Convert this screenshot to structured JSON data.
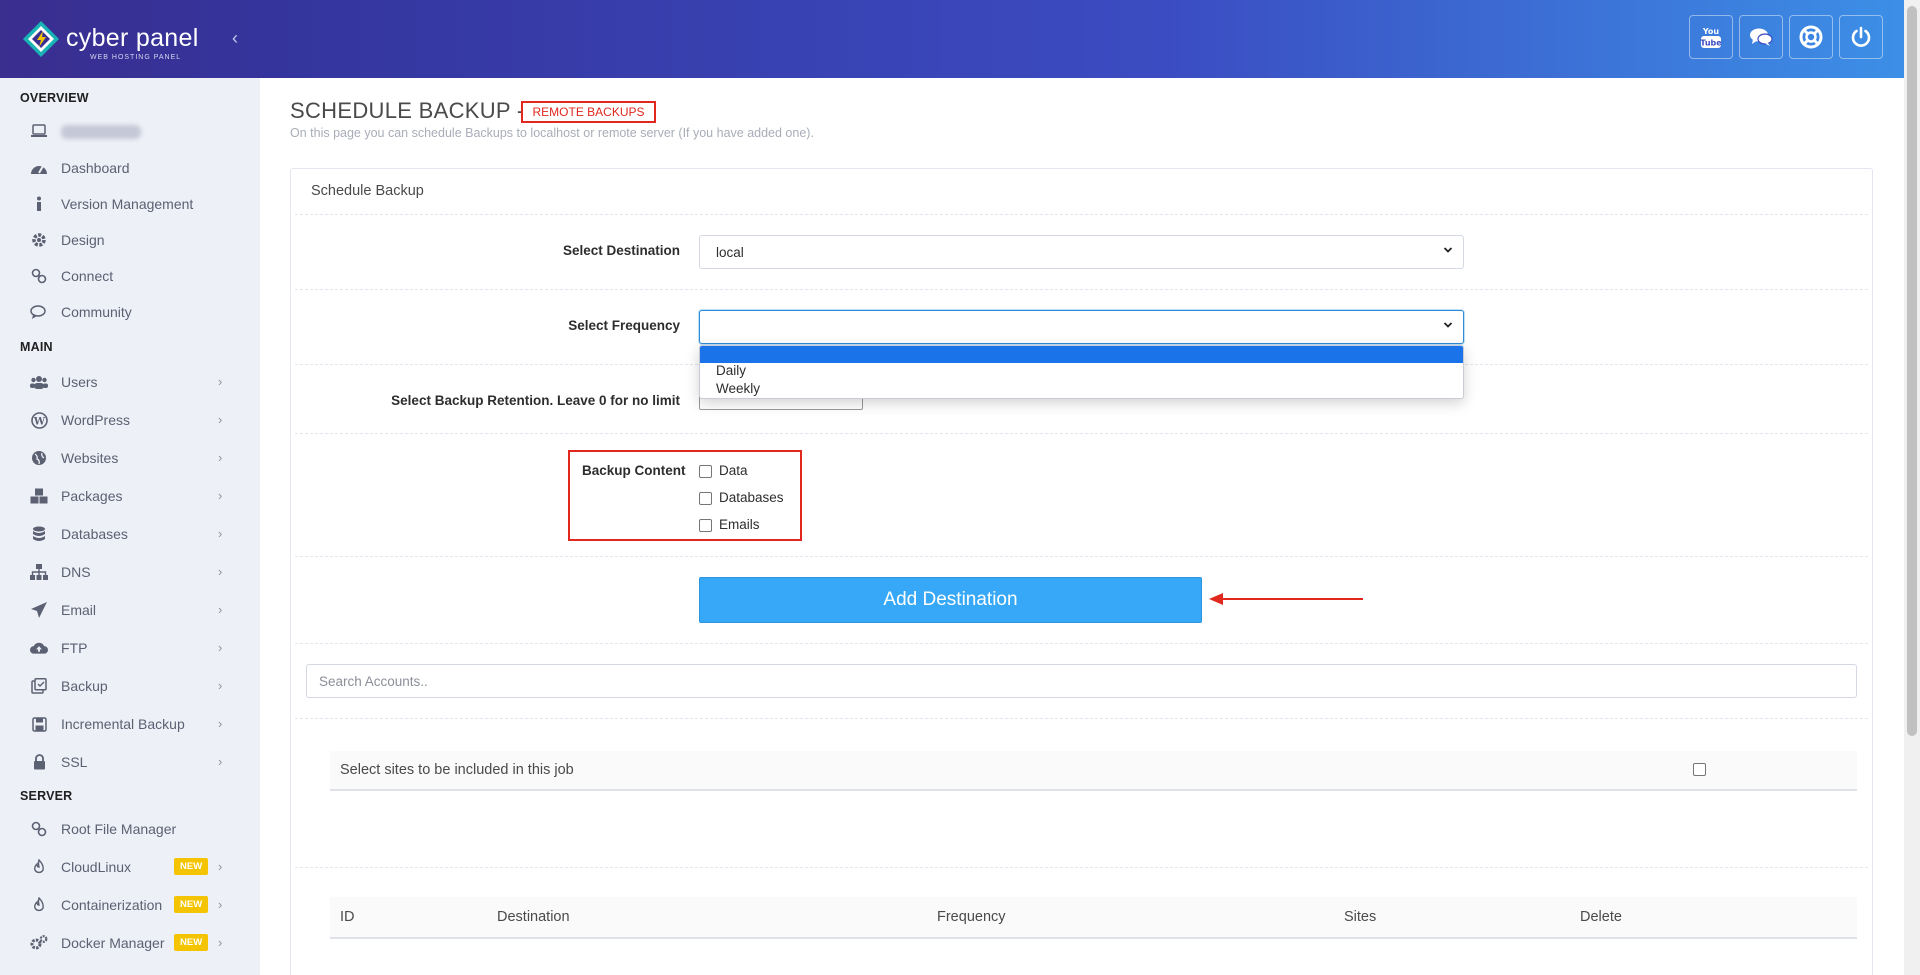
{
  "brand": {
    "name": "cyber panel",
    "tagline": "WEB HOSTING PANEL"
  },
  "colors": {
    "accent": "#36a8f7",
    "header_start": "#35349c",
    "header_end": "#3c8fe6",
    "highlight_red": "#e0281e",
    "badge": "#f4c400"
  },
  "sidebar": {
    "sections": {
      "overview": "OVERVIEW",
      "main": "MAIN",
      "server": "SERVER"
    },
    "overview_items": [
      {
        "label": "Dashboard",
        "icon": "dashboard-icon"
      },
      {
        "label": "Version Management",
        "icon": "info-icon"
      },
      {
        "label": "Design",
        "icon": "gear-icon"
      },
      {
        "label": "Connect",
        "icon": "link-icon"
      },
      {
        "label": "Community",
        "icon": "chat-icon"
      }
    ],
    "main_items": [
      {
        "label": "Users",
        "icon": "users-icon"
      },
      {
        "label": "WordPress",
        "icon": "wordpress-icon"
      },
      {
        "label": "Websites",
        "icon": "globe-icon"
      },
      {
        "label": "Packages",
        "icon": "packages-icon"
      },
      {
        "label": "Databases",
        "icon": "database-icon"
      },
      {
        "label": "DNS",
        "icon": "sitemap-icon"
      },
      {
        "label": "Email",
        "icon": "paper-plane-icon"
      },
      {
        "label": "FTP",
        "icon": "cloud-upload-icon"
      },
      {
        "label": "Backup",
        "icon": "backup-icon"
      },
      {
        "label": "Incremental Backup",
        "icon": "save-icon"
      },
      {
        "label": "SSL",
        "icon": "lock-icon"
      }
    ],
    "server_items": [
      {
        "label": "Root File Manager",
        "icon": "link-icon"
      },
      {
        "label": "CloudLinux",
        "icon": "fire-icon",
        "badge": "NEW"
      },
      {
        "label": "Containerization",
        "icon": "fire-icon",
        "badge": "NEW"
      },
      {
        "label": "Docker Manager",
        "icon": "gears-icon",
        "badge": "NEW"
      }
    ]
  },
  "header": {
    "icons": [
      "youtube-icon",
      "chat-icon",
      "support-icon",
      "power-icon"
    ]
  },
  "page": {
    "title": "SCHEDULE BACKUP -",
    "remote_button": "REMOTE BACKUPS",
    "subtitle": "On this page you can schedule Backups to localhost or remote server (If you have added one)."
  },
  "form": {
    "card_title": "Schedule Backup",
    "destination_label": "Select Destination",
    "destination_value": "local",
    "frequency_label": "Select Frequency",
    "frequency_value": "",
    "frequency_options": [
      "Daily",
      "Weekly"
    ],
    "retention_label": "Select Backup Retention. Leave 0 for no limit",
    "content_label": "Backup Content",
    "content_options": [
      "Data",
      "Databases",
      "Emails"
    ],
    "add_button": "Add Destination",
    "search_placeholder": "Search Accounts..",
    "sites_label": "Select sites to be included in this job"
  },
  "jobs_table": {
    "columns": [
      "ID",
      "Destination",
      "Frequency",
      "Sites",
      "Delete"
    ]
  }
}
